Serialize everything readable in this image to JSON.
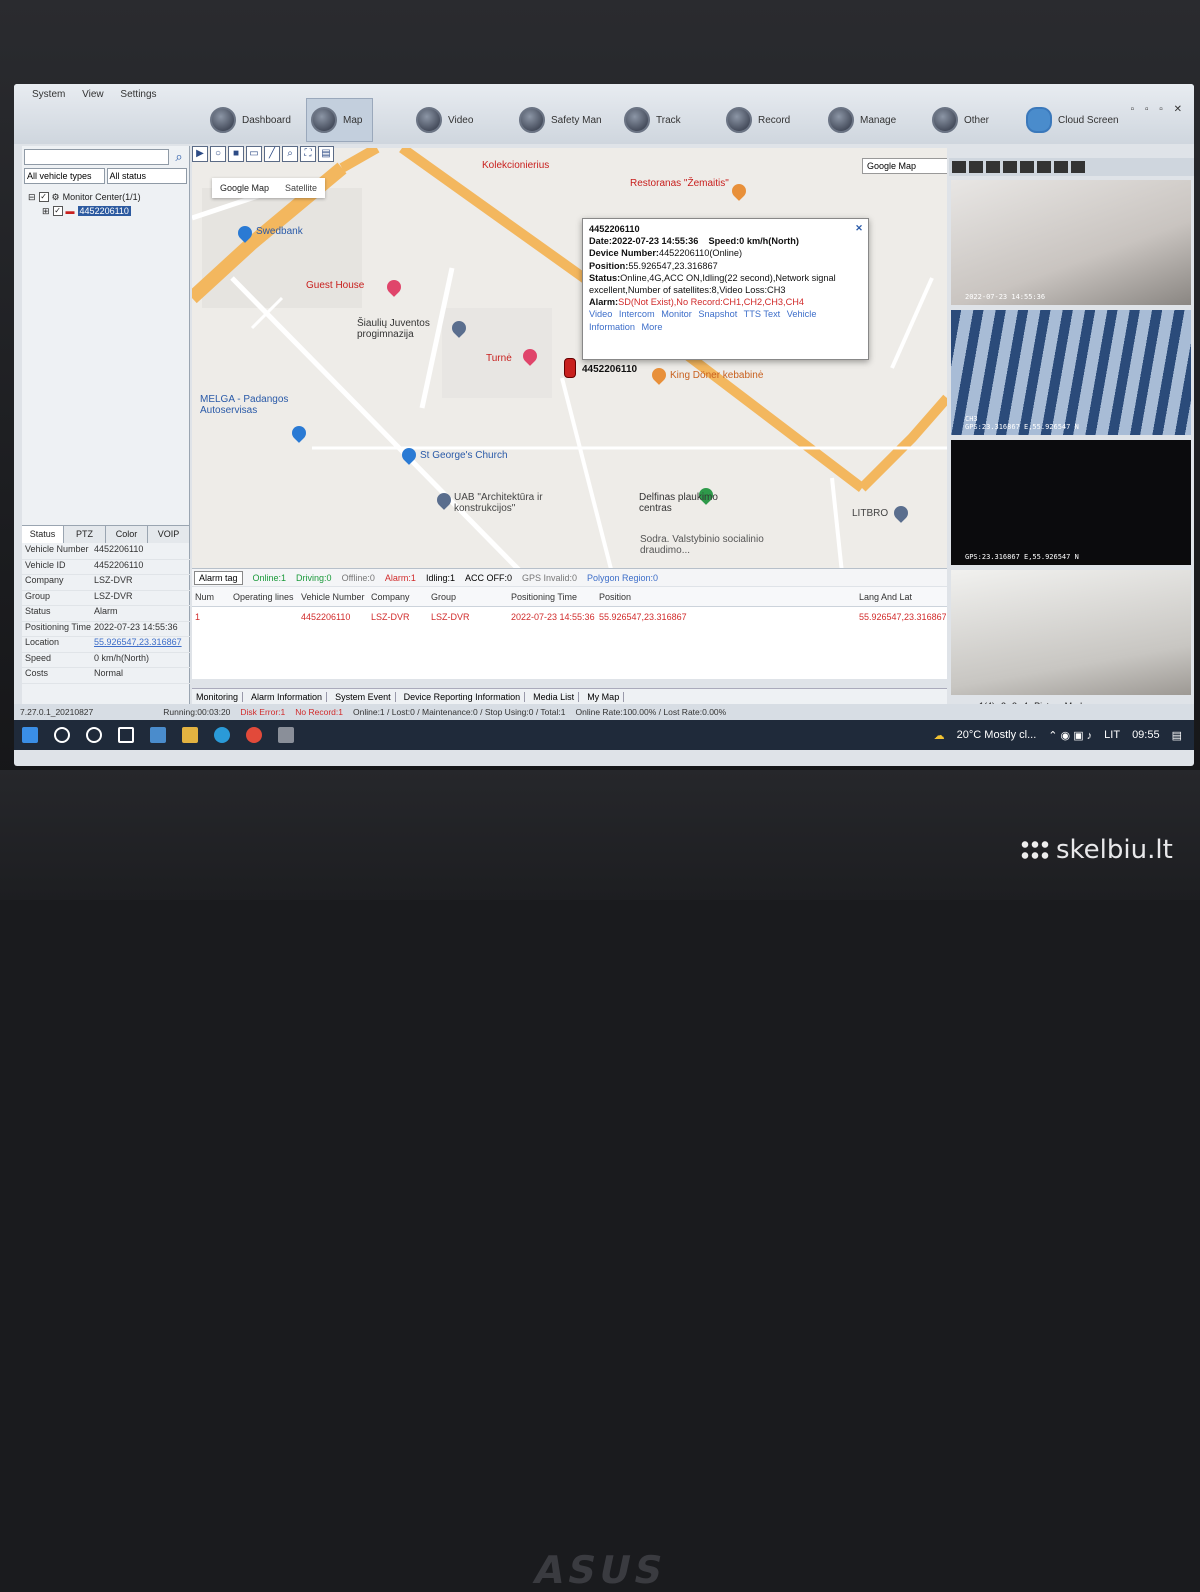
{
  "menu": [
    "System",
    "View",
    "Settings"
  ],
  "nav": [
    {
      "label": "Dashboard",
      "active": false
    },
    {
      "label": "Map",
      "active": true
    },
    {
      "label": "Video",
      "active": false
    },
    {
      "label": "Safety Man",
      "active": false
    },
    {
      "label": "Track",
      "active": false
    },
    {
      "label": "Record",
      "active": false
    },
    {
      "label": "Manage",
      "active": false
    },
    {
      "label": "Other",
      "active": false
    },
    {
      "label": "Cloud Screen",
      "active": false
    }
  ],
  "left": {
    "vehicle_filter": "All vehicle types",
    "status_filter": "All status",
    "tree_root": "Monitor Center(1/1)",
    "tree_device": "4452206110",
    "tabs": [
      "Status",
      "PTZ",
      "Color",
      "VOIP"
    ],
    "details": [
      {
        "k": "Vehicle Number",
        "v": "4452206110"
      },
      {
        "k": "Vehicle ID",
        "v": "4452206110"
      },
      {
        "k": "Company",
        "v": "LSZ-DVR"
      },
      {
        "k": "Group",
        "v": "LSZ-DVR"
      },
      {
        "k": "Status",
        "v": "Alarm"
      },
      {
        "k": "Positioning Time",
        "v": "2022-07-23 14:55:36"
      },
      {
        "k": "Location",
        "v": "55.926547,23.316867"
      },
      {
        "k": "Speed",
        "v": "0 km/h(North)"
      },
      {
        "k": "Costs",
        "v": "Normal"
      }
    ]
  },
  "map": {
    "type_options": [
      "Google Map",
      "Satellite"
    ],
    "source_select": "Google Map",
    "labels": [
      "Swedbank",
      "Guest House",
      "Šiaulių Juventos progimnazija",
      "Turnė",
      "MELGA - Padangos Autoservisas",
      "St George's Church",
      "UAB \"Architektūra ir konstrukcijos\"",
      "Delfinas plaukimo centras",
      "King Döner kebabinė",
      "Restoranas \"Žemaitis\"",
      "Kolekcionierius",
      "LITBRO",
      "Sodra. Valstybinio socialinio draudimo..."
    ],
    "car_label": "4452206110",
    "popup": {
      "id": "4452206110",
      "date_label": "Date:",
      "date": "2022-07-23 14:55:36",
      "speed_label": "Speed:",
      "speed": "0 km/h(North)",
      "device_label": "Device Number:",
      "device": "4452206110(Online)",
      "position_label": "Position:",
      "position": "55.926547,23.316867",
      "status_label": "Status:",
      "status": "Online,4G,ACC ON,Idling(22 second),Network signal excellent,Number of satellites:8,Video Loss:CH3",
      "alarm_label": "Alarm:",
      "alarm": "SD(Not Exist),No Record:CH1,CH2,CH3,CH4",
      "links": [
        "Video",
        "Intercom",
        "Monitor",
        "Snapshot",
        "TTS Text",
        "Vehicle",
        "Information",
        "More"
      ]
    }
  },
  "statusbar": {
    "alarm_tag": "Alarm tag",
    "items": [
      {
        "label": "Online:1",
        "color": "#1a9a3a"
      },
      {
        "label": "Driving:0",
        "color": "#1a9a3a"
      },
      {
        "label": "Offline:0",
        "color": "#777777"
      },
      {
        "label": "Alarm:1",
        "color": "#d12b2b"
      },
      {
        "label": "Idling:1",
        "color": "#333333"
      },
      {
        "label": "ACC OFF:0",
        "color": "#333333"
      },
      {
        "label": "GPS Invalid:0",
        "color": "#777777"
      },
      {
        "label": "Polygon Region:0",
        "color": "#3d6ec9"
      }
    ]
  },
  "table": {
    "headers": [
      "Num",
      "Operating lines",
      "Vehicle Number",
      "Company",
      "Group",
      "Positioning Time",
      "Position",
      "Lang And Lat"
    ],
    "rows": [
      {
        "num": "1",
        "lines": "",
        "vehicle": "4452206110",
        "company": "LSZ-DVR",
        "group": "LSZ-DVR",
        "time": "2022-07-23 14:55:36",
        "position": "55.926547,23.316867",
        "lat": "55.926547,23.316867"
      }
    ]
  },
  "bottom_tabs": [
    "Monitoring",
    "Alarm Information",
    "System Event",
    "Device Reporting Information",
    "Media List",
    "My Map"
  ],
  "video": {
    "cells": [
      {
        "ch": "",
        "osd": "2022-07-23 14:55:36"
      },
      {
        "ch": "CH3",
        "osd": "GPS:23.316867 E,55.926547 N"
      },
      {
        "ch": "",
        "osd": "GPS:23.316867 E,55.926547 N"
      },
      {
        "ch": "",
        "osd": ""
      }
    ],
    "pages": [
      "1(4)",
      "2",
      "3",
      "4",
      "Picture Mode"
    ]
  },
  "footer": {
    "version": "7.27.0.1_20210827",
    "running": "Running:00:03:20",
    "disk": "Disk Error:1",
    "no_record": "No Record:1",
    "stats": "Online:1 / Lost:0 / Maintenance:0 / Stop Using:0 / Total:1",
    "rates": "Online Rate:100.00% / Lost Rate:0.00%"
  },
  "taskbar": {
    "weather": "20°C  Mostly cl...",
    "lang": "LIT",
    "time": "09:55"
  },
  "watermark": "skelbiu.lt",
  "brand": "ASUS"
}
